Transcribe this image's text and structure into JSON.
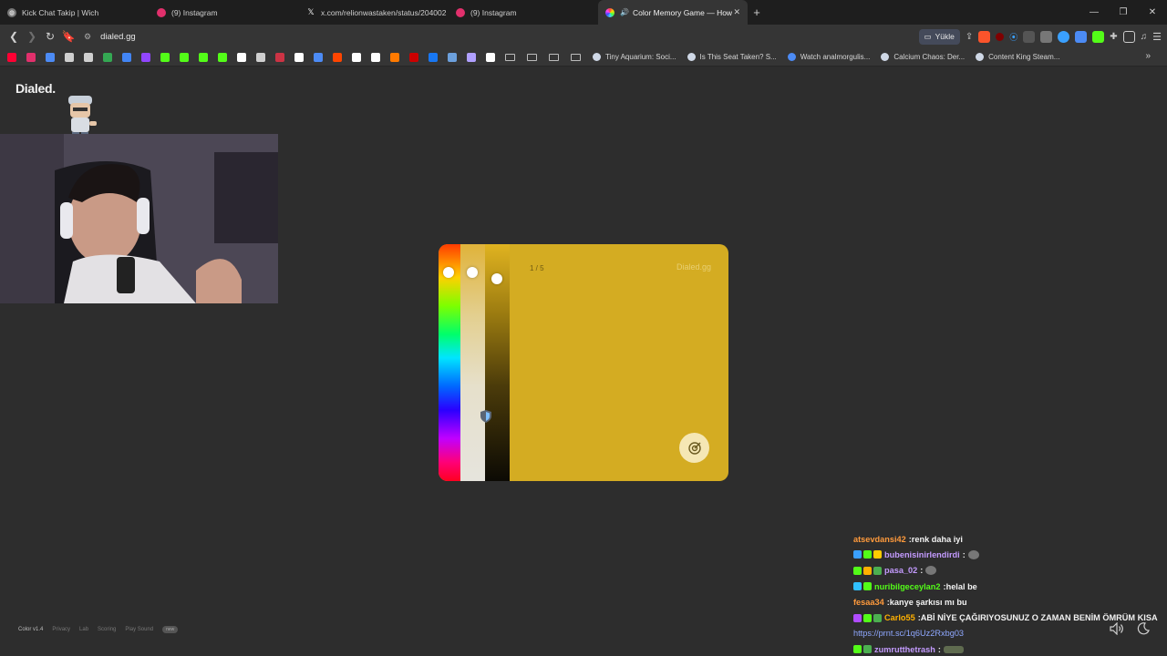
{
  "browser": {
    "tabs": [
      {
        "title": "Kick Chat Takip | Wich",
        "favicon_color": "#aaaaaa"
      },
      {
        "title": "(9) Instagram",
        "favicon_color": "#e1306c"
      },
      {
        "title": "x.com/relionwastaken/status/204002",
        "favicon_color": "#ffffff"
      },
      {
        "title": "(9) Instagram",
        "favicon_color": "#e1306c"
      },
      {
        "title": "Color Memory Game — How",
        "favicon_color": "#ffb300",
        "active": true
      }
    ],
    "new_tab_label": "+",
    "window_controls": {
      "minimize": "—",
      "restore": "❐",
      "close": "✕"
    },
    "url": "dialed.gg",
    "load_button": "Yükle",
    "bookmarks": [
      {
        "title": "Tiny Aquarium: Soci..."
      },
      {
        "title": "Is This Seat Taken? S..."
      },
      {
        "title": "Watch analmorgulis..."
      },
      {
        "title": "Calcium Chaos: Der..."
      },
      {
        "title": "Content King Steam..."
      }
    ],
    "bookmark_icon_colors": [
      "#ff0033",
      "#e1306c",
      "#4c8bf5",
      "#cfcfcf",
      "#cfcfcf",
      "#34a853",
      "#4285f4",
      "#9146ff",
      "#53fc18",
      "#53fc18",
      "#53fc18",
      "#53fc18",
      "#ffffff",
      "#cfcfcf",
      "#cc3344",
      "#ffffff",
      "#4c8bf5",
      "#ff4500",
      "#ffffff",
      "#ffffff",
      "#ff7a00",
      "#cc0000",
      "#1877f2",
      "#6ca0dc",
      "#b0a0ff",
      "#ffffff"
    ]
  },
  "page": {
    "brand": "Dialed.",
    "game": {
      "counter": "1 / 5",
      "watermark": "Dialed.gg",
      "target_color": "#d4ac22"
    },
    "footer": [
      "Color v1.4",
      "Privacy",
      "Lab",
      "Scoring",
      "Play Sound",
      "new"
    ]
  },
  "chat": [
    {
      "user": "atsevdansi42",
      "user_color": "#ff9a3c",
      "msg": "renk daha iyi",
      "badges": []
    },
    {
      "user": "bubenisinirlendirdi",
      "user_color": "#c49bff",
      "msg": "",
      "badges": [
        "#3aa0ff",
        "#53fc18",
        "#ffcc00"
      ],
      "emote": true
    },
    {
      "user": "pasa_02",
      "user_color": "#c49bff",
      "msg": "",
      "badges": [
        "#53fc18",
        "#ffb000",
        "#4caf50"
      ],
      "emote": true
    },
    {
      "user": "nuribilgeceylan2",
      "user_color": "#53fc18",
      "msg": "helal be",
      "badges": [
        "#30c0ff",
        "#53fc18"
      ]
    },
    {
      "user": "fesaa34",
      "user_color": "#ff9a3c",
      "msg": "kanye şarkısı mı bu",
      "badges": []
    },
    {
      "user": "Carlo55",
      "user_color": "#ffb000",
      "msg": "ABİ NİYE ÇAĞIRIYOSUNUZ O ZAMAN BENİM ÖMRÜM KISA",
      "badges": [
        "#b04cff",
        "#53fc18",
        "#4caf50"
      ]
    },
    {
      "user": "",
      "user_color": "#8fa8ff",
      "msg": "https://prnt.sc/1q6Uz2Rxbg03",
      "badges": [],
      "link": true
    },
    {
      "user": "zumrutthetrash",
      "user_color": "#c49bff",
      "msg": "",
      "badges": [
        "#53fc18",
        "#4caf50"
      ],
      "emote_wide": true
    }
  ]
}
